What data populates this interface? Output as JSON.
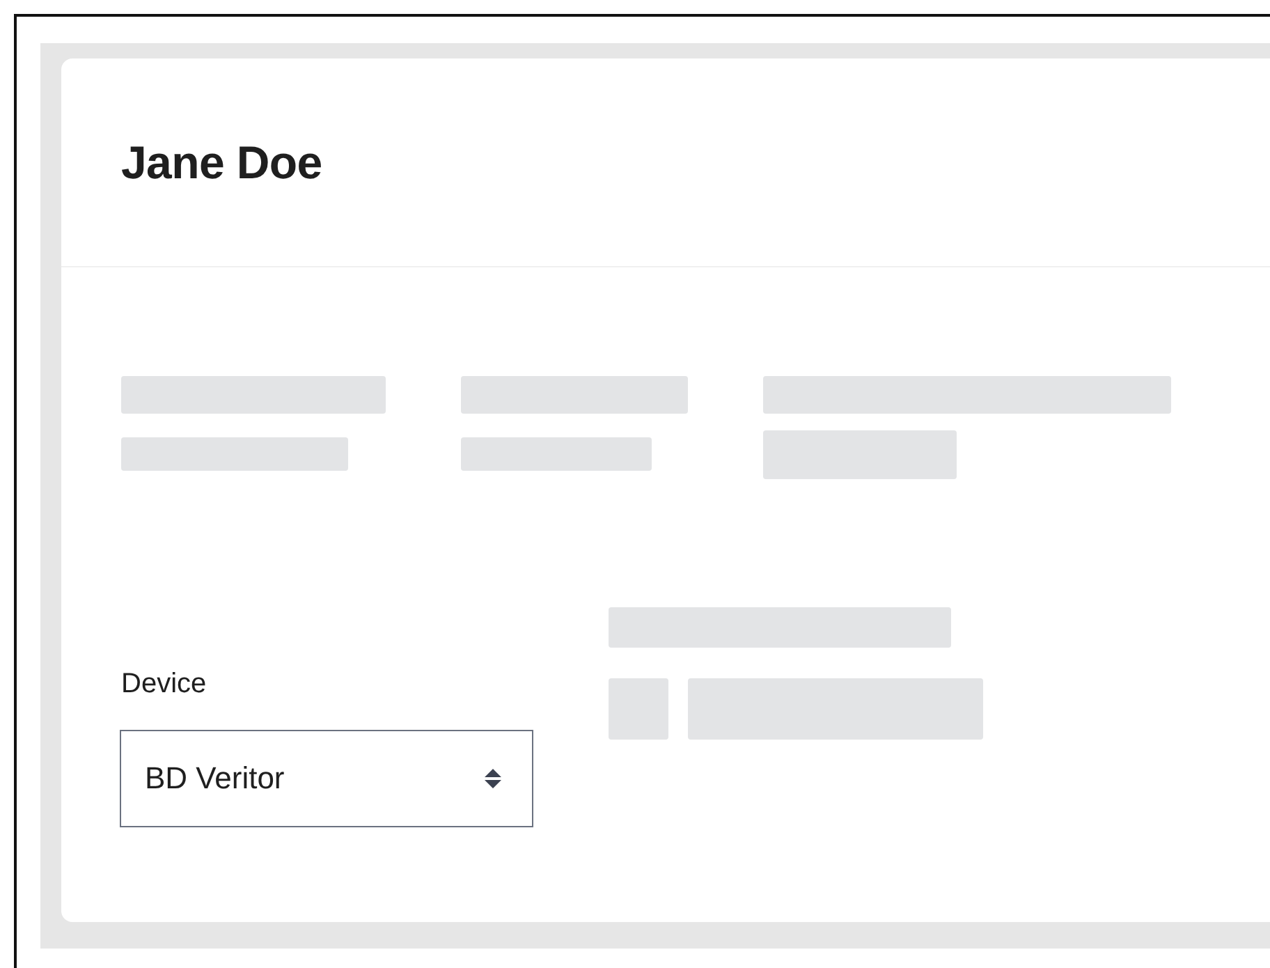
{
  "profile": {
    "name": "Jane Doe"
  },
  "device_field": {
    "label": "Device",
    "value": "BD Veritor"
  }
}
